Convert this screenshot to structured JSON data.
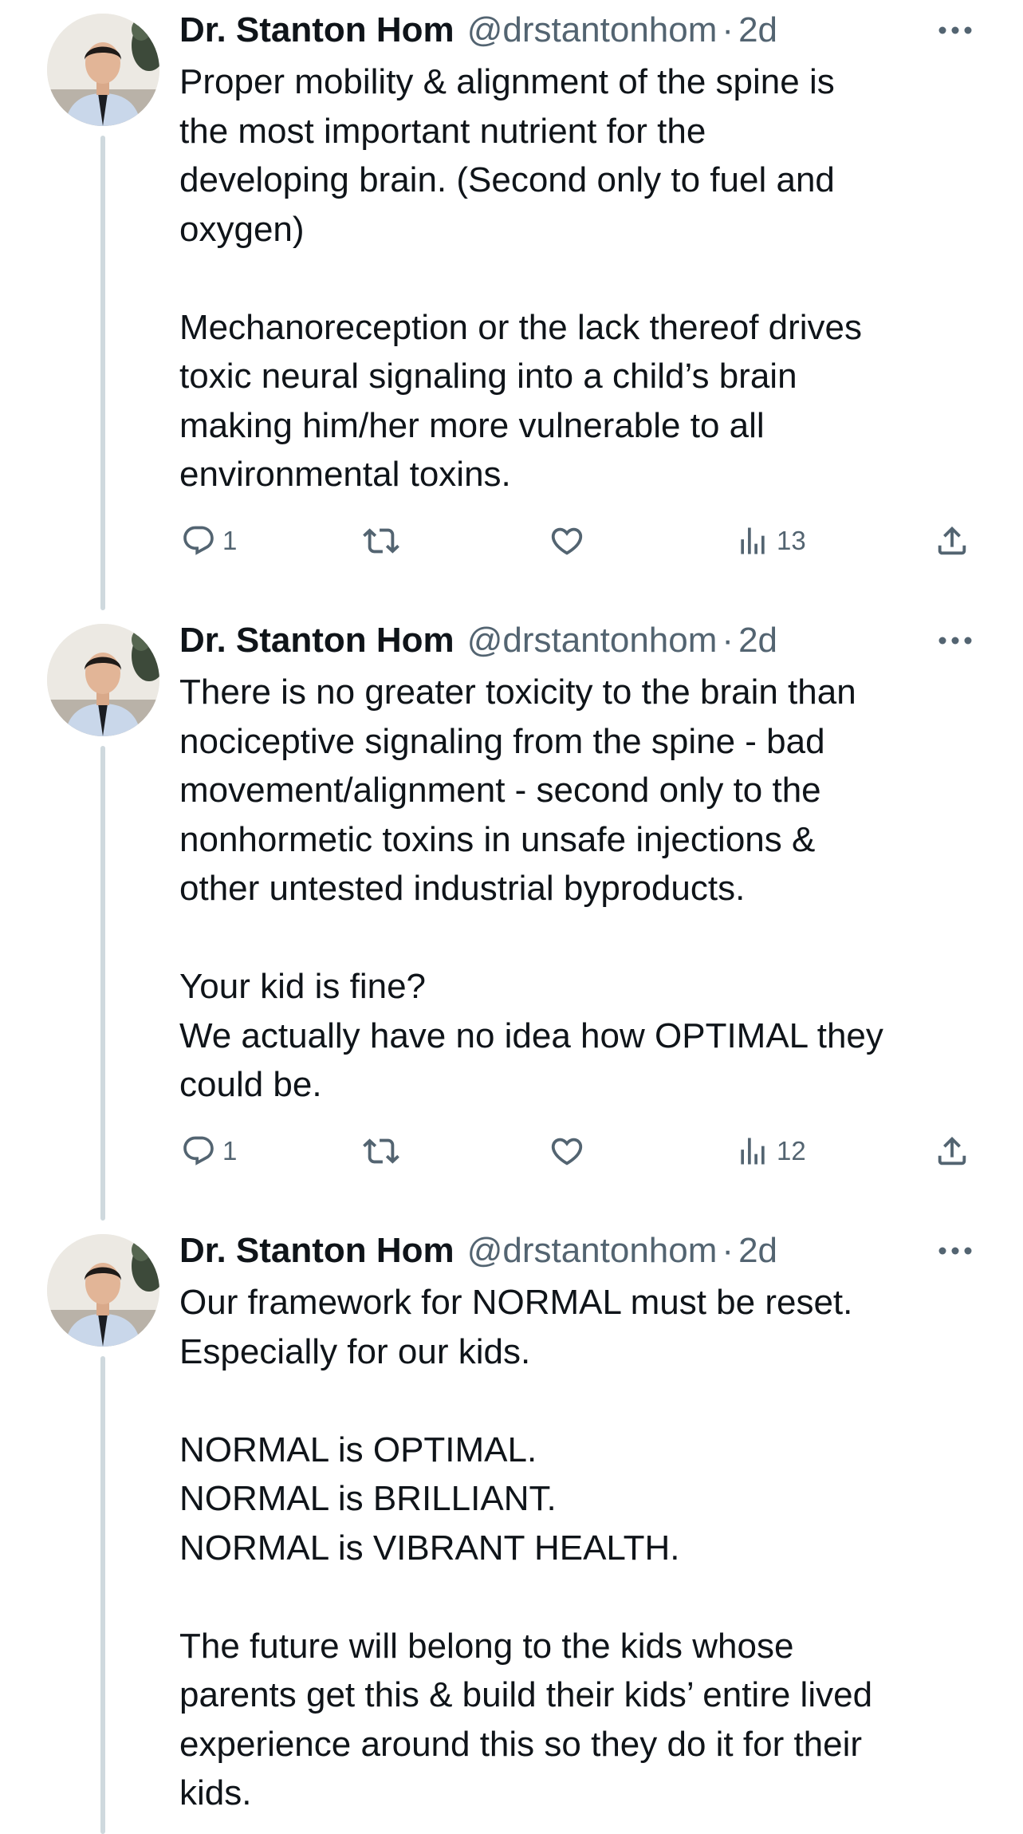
{
  "colors": {
    "text_primary": "#0f1419",
    "text_secondary": "#536471",
    "thread_line": "#cfd9de",
    "background": "#ffffff"
  },
  "tweets": [
    {
      "author_name": "Dr. Stanton Hom",
      "handle": "@drstantonhom",
      "separator": "·",
      "time": "2d",
      "paragraphs": [
        [
          "Proper mobility & alignment of the spine is",
          "the most important nutrient for the",
          "developing brain. (Second only to fuel and",
          "oxygen)"
        ],
        [
          "Mechanoreception or the lack thereof drives",
          "toxic neural signaling into a child’s brain",
          "making him/her more vulnerable to all",
          "environmental toxins."
        ]
      ],
      "actions": {
        "reply_count": "1",
        "views_count": "13"
      }
    },
    {
      "author_name": "Dr. Stanton Hom",
      "handle": "@drstantonhom",
      "separator": "·",
      "time": "2d",
      "paragraphs": [
        [
          "There is no greater toxicity to the brain than",
          "nociceptive signaling from the spine - bad",
          "movement/alignment - second only to the",
          "nonhormetic toxins in unsafe injections &",
          "other untested industrial byproducts."
        ],
        [
          "Your kid is fine?",
          "We actually have no idea how OPTIMAL they",
          "could be."
        ]
      ],
      "actions": {
        "reply_count": "1",
        "views_count": "12"
      }
    },
    {
      "author_name": "Dr. Stanton Hom",
      "handle": "@drstantonhom",
      "separator": "·",
      "time": "2d",
      "paragraphs": [
        [
          "Our framework for NORMAL must be reset.",
          "Especially for our kids."
        ],
        [
          "NORMAL is OPTIMAL.",
          "NORMAL is BRILLIANT.",
          "NORMAL is VIBRANT HEALTH."
        ],
        [
          "The future will belong to the kids whose",
          "parents get this & build their kids’ entire lived",
          "experience around this so they do it for their",
          "kids."
        ]
      ]
    }
  ],
  "icons": {
    "more": "more-horizontal-icon",
    "reply": "reply-bubble-icon",
    "retweet": "retweet-icon",
    "like": "heart-icon",
    "views": "views-bar-chart-icon",
    "share": "share-upload-icon"
  }
}
